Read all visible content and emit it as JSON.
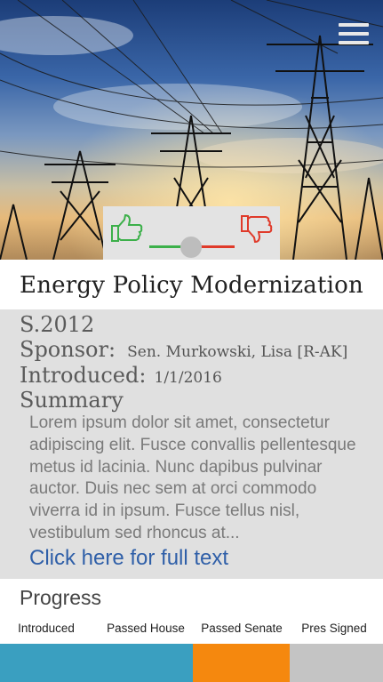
{
  "header": {
    "menu_icon": "hamburger-menu-icon"
  },
  "vote": {
    "up_icon": "thumbs-up-icon",
    "down_icon": "thumbs-down-icon",
    "up_color": "#3cb04a",
    "down_color": "#e03a2a"
  },
  "bill": {
    "title": "Energy Policy Modernization",
    "number": "S.2012",
    "sponsor_label": "Sponsor:",
    "sponsor_value": "Sen. Murkowski, Lisa [R-AK]",
    "introduced_label": "Introduced:",
    "introduced_value": "1/1/2016",
    "summary_label": "Summary",
    "summary_text": "Lorem ipsum dolor sit amet, consectetur adipiscing elit. Fusce convallis pellentesque metus id lacinia. Nunc dapibus pulvinar auctor. Duis nec sem at orci commodo viverra id in ipsum. Fusce tellus nisl, vestibulum sed rhoncus at...",
    "full_text_link": "Click here for full text"
  },
  "progress": {
    "title": "Progress",
    "stages": [
      "Introduced",
      "Passed House",
      "Passed Senate",
      "Pres Signed"
    ],
    "colors": {
      "completed": "#3a9fc0",
      "current": "#f5880e",
      "pending": "#c4c4c4"
    }
  }
}
